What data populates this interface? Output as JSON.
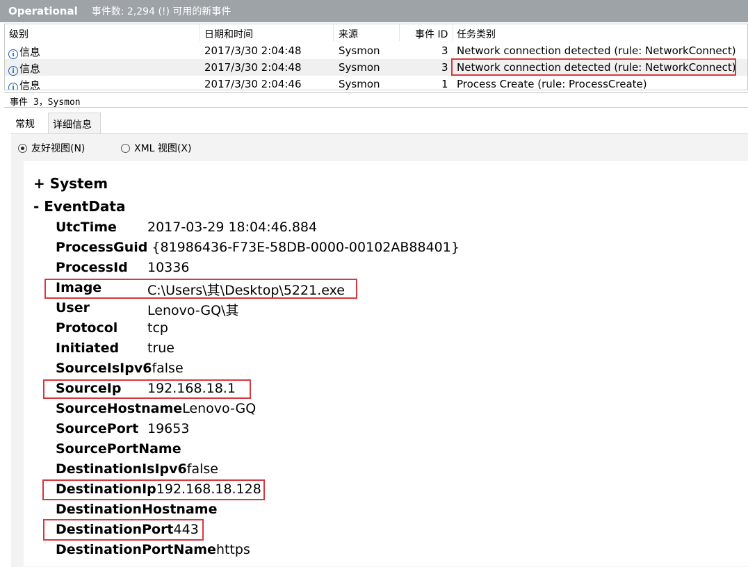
{
  "titlebar": {
    "log_name": "Operational",
    "event_count": "事件数: 2,294 (!) 可用的新事件"
  },
  "columns": {
    "level": "级别",
    "datetime": "日期和时间",
    "source": "来源",
    "event_id": "事件 ID",
    "task_category": "任务类别"
  },
  "rows": [
    {
      "icon": "info-icon",
      "level": "信息",
      "datetime": "2017/3/30 2:04:48",
      "source": "Sysmon",
      "event_id": "3",
      "task_category": "Network connection detected (rule: NetworkConnect)"
    },
    {
      "icon": "info-icon",
      "level": "信息",
      "datetime": "2017/3/30 2:04:48",
      "source": "Sysmon",
      "event_id": "3",
      "task_category": "Network connection detected (rule: NetworkConnect)",
      "selected": true
    },
    {
      "icon": "info-icon",
      "level": "信息",
      "datetime": "2017/3/30 2:04:46",
      "source": "Sysmon",
      "event_id": "1",
      "task_category": "Process Create (rule: ProcessCreate)"
    }
  ],
  "event_header": "事件 3，Sysmon",
  "tabs": [
    {
      "label": "常规",
      "active": false
    },
    {
      "label": "详细信息",
      "active": true
    }
  ],
  "view_options": {
    "friendly": "友好视图(N)",
    "xml": "XML 视图(X)",
    "selected": "friendly"
  },
  "details": {
    "system_label": "+ System",
    "eventdata_label": "-  EventData",
    "fields": [
      {
        "key": "UtcTime",
        "value": "2017-03-29 18:04:46.884"
      },
      {
        "key": "ProcessGuid",
        "value": "{81986436-F73E-58DB-0000-00102AB88401}"
      },
      {
        "key": "ProcessId",
        "value": "10336"
      },
      {
        "key": "Image",
        "value": "C:\\Users\\其\\Desktop\\5221.exe"
      },
      {
        "key": "User",
        "value": "Lenovo-GQ\\其"
      },
      {
        "key": "Protocol",
        "value": "tcp"
      },
      {
        "key": "Initiated",
        "value": "true"
      },
      {
        "key": "SourceIsIpv6",
        "value": "false"
      },
      {
        "key": "SourceIp",
        "value": "192.168.18.1"
      },
      {
        "key": "SourceHostname",
        "value": "Lenovo-GQ"
      },
      {
        "key": "SourcePort",
        "value": "19653"
      },
      {
        "key": "SourcePortName",
        "value": ""
      },
      {
        "key": "DestinationIsIpv6",
        "value": "false"
      },
      {
        "key": "DestinationIp",
        "value": "192.168.18.128"
      },
      {
        "key": "DestinationHostname",
        "value": ""
      },
      {
        "key": "DestinationPort",
        "value": "443"
      },
      {
        "key": "DestinationPortName",
        "value": "https"
      }
    ]
  },
  "colors": {
    "highlight_box": "#d9363e",
    "titlebar_bg": "#9ea3a8",
    "info_icon": "#1c5fb0"
  }
}
